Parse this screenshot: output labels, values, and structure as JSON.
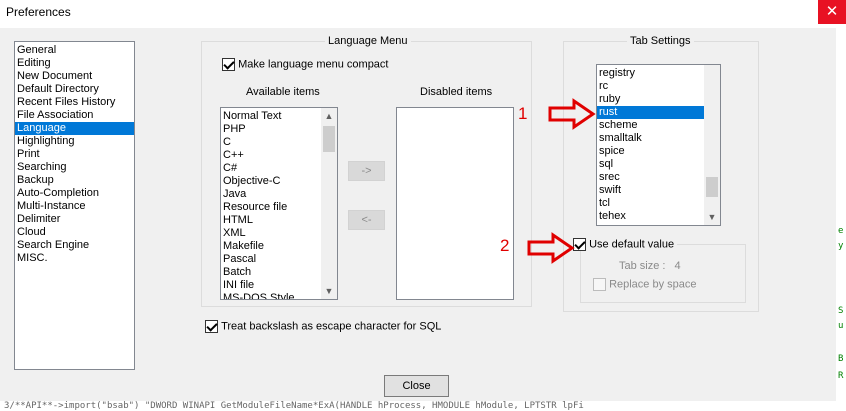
{
  "window": {
    "title": "Preferences",
    "close_glyph": "✕"
  },
  "categories": {
    "items": [
      "General",
      "Editing",
      "New Document",
      "Default Directory",
      "Recent Files History",
      "File Association",
      "Language",
      "Highlighting",
      "Print",
      "Searching",
      "Backup",
      "Auto-Completion",
      "Multi-Instance",
      "Delimiter",
      "Cloud",
      "Search Engine",
      "MISC."
    ],
    "selected": "Language"
  },
  "language_menu": {
    "title": "Language Menu",
    "compact_label": "Make language menu compact",
    "compact_checked": true,
    "available_label": "Available items",
    "disabled_label": "Disabled items",
    "available_items": [
      "Normal Text",
      "PHP",
      "C",
      "C++",
      "C#",
      "Objective-C",
      "Java",
      "Resource file",
      "HTML",
      "XML",
      "Makefile",
      "Pascal",
      "Batch",
      "INI file",
      "MS-DOS Style"
    ],
    "move_right_label": "->",
    "move_left_label": "<-"
  },
  "tab_settings": {
    "title": "Tab Settings",
    "languages": [
      "registry",
      "rc",
      "ruby",
      "rust",
      "scheme",
      "smalltalk",
      "spice",
      "sql",
      "srec",
      "swift",
      "tcl",
      "tehex"
    ],
    "selected": "rust",
    "use_default_label": "Use default value",
    "use_default_checked": true,
    "tab_size_label": "Tab size :",
    "tab_size_value": "4",
    "replace_label": "Replace by space"
  },
  "sql_option": {
    "label": "Treat backslash as escape character for SQL",
    "checked": true
  },
  "close_button": "Close",
  "annotations": {
    "marker1": "1",
    "marker2": "2",
    "arrow_color": "#e00000"
  },
  "background_code": "3/**API**->import(\"bsab\") \"DWORD WINAPI GetModuleFileName*ExA(HANDLE  hProcess, HMODULE  hModule, LPTSTR  lpFi"
}
